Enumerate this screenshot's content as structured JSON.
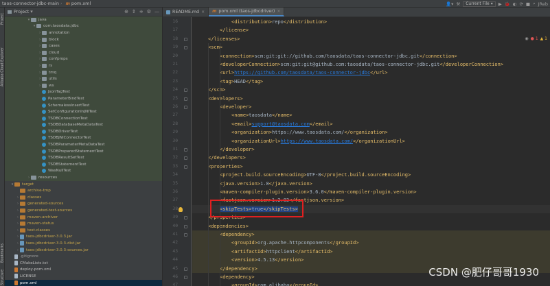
{
  "topbar": {
    "project_name": "taos-connector-jdbc-main",
    "file_name": "pom.xml",
    "run_config": "Current File"
  },
  "left_strip": {
    "tabs": [
      "Project",
      "Alibaba Cloud Explorer",
      "Bookmarks",
      "Structure"
    ]
  },
  "project_panel": {
    "title": "Project",
    "tree": [
      {
        "label": "java",
        "depth": 4,
        "arrow": "open",
        "icon": "folder",
        "style": "greenish"
      },
      {
        "label": "com.taosdata.jdbc",
        "depth": 5,
        "arrow": "open",
        "icon": "pkg",
        "style": "greenish"
      },
      {
        "label": "annotation",
        "depth": 6,
        "arrow": "closed",
        "icon": "pkg",
        "style": "greenish"
      },
      {
        "label": "block",
        "depth": 6,
        "arrow": "closed",
        "icon": "pkg",
        "style": "greenish"
      },
      {
        "label": "cases",
        "depth": 6,
        "arrow": "closed",
        "icon": "pkg",
        "style": "greenish"
      },
      {
        "label": "cloud",
        "depth": 6,
        "arrow": "closed",
        "icon": "pkg",
        "style": "greenish"
      },
      {
        "label": "confprops",
        "depth": 6,
        "arrow": "closed",
        "icon": "pkg",
        "style": "greenish"
      },
      {
        "label": "rs",
        "depth": 6,
        "arrow": "closed",
        "icon": "pkg",
        "style": "greenish"
      },
      {
        "label": "tmq",
        "depth": 6,
        "arrow": "closed",
        "icon": "pkg",
        "style": "greenish"
      },
      {
        "label": "utils",
        "depth": 6,
        "arrow": "closed",
        "icon": "pkg",
        "style": "greenish"
      },
      {
        "label": "ws",
        "depth": 6,
        "arrow": "closed",
        "icon": "pkg",
        "style": "greenish"
      },
      {
        "label": "JsonTagTest",
        "depth": 6,
        "arrow": "",
        "icon": "class",
        "style": "greenish"
      },
      {
        "label": "ParameterBindTest",
        "depth": 6,
        "arrow": "",
        "icon": "class",
        "style": "greenish"
      },
      {
        "label": "SchemalessInsertTest",
        "depth": 6,
        "arrow": "",
        "icon": "class",
        "style": "greenish"
      },
      {
        "label": "SetConfigurationInJNITest",
        "depth": 6,
        "arrow": "",
        "icon": "class",
        "style": "greenish"
      },
      {
        "label": "TSDBConnectionTest",
        "depth": 6,
        "arrow": "",
        "icon": "class",
        "style": "greenish"
      },
      {
        "label": "TSDBDatabaseMetaDataTest",
        "depth": 6,
        "arrow": "",
        "icon": "class",
        "style": "greenish"
      },
      {
        "label": "TSDBDriverTest",
        "depth": 6,
        "arrow": "",
        "icon": "class",
        "style": "greenish"
      },
      {
        "label": "TSDBJNIConnectorTest",
        "depth": 6,
        "arrow": "",
        "icon": "class",
        "style": "greenish"
      },
      {
        "label": "TSDBParameterMetaDataTest",
        "depth": 6,
        "arrow": "",
        "icon": "class",
        "style": "greenish"
      },
      {
        "label": "TSDBPreparedStatementTest",
        "depth": 6,
        "arrow": "",
        "icon": "class",
        "style": "greenish"
      },
      {
        "label": "TSDBResultSetTest",
        "depth": 6,
        "arrow": "",
        "icon": "class",
        "style": "greenish"
      },
      {
        "label": "TSDBStatementTest",
        "depth": 6,
        "arrow": "",
        "icon": "class",
        "style": "greenish"
      },
      {
        "label": "WasNullTest",
        "depth": 6,
        "arrow": "",
        "icon": "class",
        "style": "greenish"
      },
      {
        "label": "resources",
        "depth": 4,
        "arrow": "closed",
        "icon": "folder",
        "style": "greenish"
      },
      {
        "label": "target",
        "depth": 1,
        "arrow": "open",
        "icon": "folder-orange",
        "style": "yellowish"
      },
      {
        "label": "archive-tmp",
        "depth": 2,
        "arrow": "",
        "icon": "folder-orange",
        "style": "yellowish"
      },
      {
        "label": "classes",
        "depth": 2,
        "arrow": "closed",
        "icon": "folder-orange",
        "style": "yellowish"
      },
      {
        "label": "generated-sources",
        "depth": 2,
        "arrow": "closed",
        "icon": "folder-orange",
        "style": "yellowish"
      },
      {
        "label": "generated-test-sources",
        "depth": 2,
        "arrow": "closed",
        "icon": "folder-orange",
        "style": "yellowish"
      },
      {
        "label": "maven-archiver",
        "depth": 2,
        "arrow": "closed",
        "icon": "folder-orange",
        "style": "yellowish"
      },
      {
        "label": "maven-status",
        "depth": 2,
        "arrow": "closed",
        "icon": "folder-orange",
        "style": "yellowish"
      },
      {
        "label": "test-classes",
        "depth": 2,
        "arrow": "closed",
        "icon": "folder-orange",
        "style": "yellowish"
      },
      {
        "label": "taos-jdbcdriver-3.0.3.jar",
        "depth": 2,
        "arrow": "closed",
        "icon": "jar",
        "style": "yellowish"
      },
      {
        "label": "taos-jdbcdriver-3.0.3-dist.jar",
        "depth": 2,
        "arrow": "closed",
        "icon": "jar",
        "style": "yellowish"
      },
      {
        "label": "taos-jdbcdriver-3.0.3-sources.jar",
        "depth": 2,
        "arrow": "closed",
        "icon": "jar",
        "style": "yellowish"
      },
      {
        "label": ".gitignore",
        "depth": 1,
        "arrow": "",
        "icon": "file",
        "style": "gray"
      },
      {
        "label": "CMakeLists.txt",
        "depth": 1,
        "arrow": "",
        "icon": "file",
        "style": "normal"
      },
      {
        "label": "deploy-pom.xml",
        "depth": 1,
        "arrow": "",
        "icon": "xml",
        "style": "normal"
      },
      {
        "label": "LICENSE",
        "depth": 1,
        "arrow": "",
        "icon": "file",
        "style": "normal"
      },
      {
        "label": "pom.xml",
        "depth": 1,
        "arrow": "",
        "icon": "xml",
        "style": "selected"
      },
      {
        "label": "README.md",
        "depth": 1,
        "arrow": "",
        "icon": "file",
        "style": "normal"
      }
    ]
  },
  "editor": {
    "tabs": [
      {
        "label": "README.md",
        "active": false,
        "icon": "md-icon"
      },
      {
        "label": "pom.xml (taos-jdbcdriver)",
        "active": true,
        "icon": "m-icon"
      }
    ],
    "inspections": {
      "errors": "1",
      "warnings": "1"
    },
    "lines": [
      {
        "num": "16",
        "indent": 3,
        "tokens": [
          [
            "tag",
            "<distribution>"
          ],
          [
            "txt",
            "repo"
          ],
          [
            "tag",
            "</distribution>"
          ]
        ]
      },
      {
        "num": "17",
        "indent": 2,
        "tokens": [
          [
            "tag",
            "</license>"
          ]
        ]
      },
      {
        "num": "18",
        "indent": 1,
        "tokens": [
          [
            "tag",
            "</licenses>"
          ]
        ]
      },
      {
        "num": "19",
        "indent": 1,
        "tokens": [
          [
            "tag",
            "<scm>"
          ]
        ]
      },
      {
        "num": "20",
        "indent": 2,
        "tokens": [
          [
            "tag",
            "<connection>"
          ],
          [
            "txt",
            "scm:git:git://github.com/taosdata/taos-connector-jdbc.git"
          ],
          [
            "tag",
            "</connection>"
          ]
        ]
      },
      {
        "num": "21",
        "indent": 2,
        "tokens": [
          [
            "tag",
            "<developerConnection>"
          ],
          [
            "txt",
            "scm:git:git@github.com:taosdata/taos-connector-jdbc.git"
          ],
          [
            "tag",
            "</developerConnection>"
          ]
        ]
      },
      {
        "num": "22",
        "indent": 2,
        "tokens": [
          [
            "tag",
            "<url>"
          ],
          [
            "url",
            "https://github.com/taosdata/taos-connector-jdbc"
          ],
          [
            "tag",
            "</url>"
          ]
        ]
      },
      {
        "num": "23",
        "indent": 2,
        "tokens": [
          [
            "tag",
            "<tag>"
          ],
          [
            "txt",
            "HEAD"
          ],
          [
            "tag",
            "</tag>"
          ]
        ]
      },
      {
        "num": "24",
        "indent": 1,
        "tokens": [
          [
            "tag",
            "</scm>"
          ]
        ]
      },
      {
        "num": "25",
        "indent": 1,
        "tokens": [
          [
            "tag",
            "<developers>"
          ]
        ]
      },
      {
        "num": "26",
        "indent": 2,
        "tokens": [
          [
            "tag",
            "<developer>"
          ]
        ]
      },
      {
        "num": "27",
        "indent": 3,
        "tokens": [
          [
            "tag",
            "<name>"
          ],
          [
            "txt",
            "taosdata"
          ],
          [
            "tag",
            "</name>"
          ]
        ]
      },
      {
        "num": "28",
        "indent": 3,
        "tokens": [
          [
            "tag",
            "<email>"
          ],
          [
            "url",
            "support@taosdata.com"
          ],
          [
            "tag",
            "</email>"
          ]
        ]
      },
      {
        "num": "29",
        "indent": 3,
        "tokens": [
          [
            "tag",
            "<organization>"
          ],
          [
            "txt",
            "https://www.taosdata.com/"
          ],
          [
            "tag",
            "</organization>"
          ]
        ]
      },
      {
        "num": "30",
        "indent": 3,
        "tokens": [
          [
            "tag",
            "<organizationUrl>"
          ],
          [
            "url",
            "https://www.taosdata.com/"
          ],
          [
            "tag",
            "</organizationUrl>"
          ]
        ]
      },
      {
        "num": "31",
        "indent": 2,
        "tokens": [
          [
            "tag",
            "</developer>"
          ]
        ]
      },
      {
        "num": "32",
        "indent": 1,
        "tokens": [
          [
            "tag",
            "</developers>"
          ]
        ]
      },
      {
        "num": "33",
        "indent": 1,
        "tokens": [
          [
            "tag",
            "<properties>"
          ]
        ]
      },
      {
        "num": "34",
        "indent": 2,
        "tokens": [
          [
            "tag",
            "<project.build.sourceEncoding>"
          ],
          [
            "txt",
            "UTF-8"
          ],
          [
            "tag",
            "</project.build.sourceEncoding>"
          ]
        ]
      },
      {
        "num": "35",
        "indent": 2,
        "tokens": [
          [
            "tag",
            "<java.version>"
          ],
          [
            "txt",
            "1.8"
          ],
          [
            "tag",
            "</java.version>"
          ]
        ]
      },
      {
        "num": "36",
        "indent": 2,
        "tokens": [
          [
            "tag",
            "<maven-compiler-plugin.version>"
          ],
          [
            "txt",
            "3.6.0"
          ],
          [
            "tag",
            "</maven-compiler-plugin.version>"
          ]
        ]
      },
      {
        "num": "37",
        "indent": 2,
        "tokens": [
          [
            "tag",
            "<fastjson.version>"
          ],
          [
            "txt",
            "1.2.83"
          ],
          [
            "tag",
            "</fastjson.version>"
          ]
        ]
      },
      {
        "num": "38",
        "indent": 2,
        "tokens": [
          [
            "sel-tag",
            "<skipTests>"
          ],
          [
            "sel-txt",
            "true"
          ],
          [
            "sel-tag",
            "</skipTests>"
          ]
        ]
      },
      {
        "num": "39",
        "indent": 1,
        "tokens": [
          [
            "tag",
            "</properties>"
          ]
        ]
      },
      {
        "num": "40",
        "indent": 1,
        "tokens": [
          [
            "tag",
            "<dependencies>"
          ]
        ]
      },
      {
        "num": "41",
        "indent": 2,
        "tokens": [
          [
            "tag",
            "<dependency>"
          ]
        ]
      },
      {
        "num": "42",
        "indent": 3,
        "tokens": [
          [
            "tag",
            "<groupId>"
          ],
          [
            "txt",
            "org.apache.httpcomponents"
          ],
          [
            "tag",
            "</groupId>"
          ]
        ]
      },
      {
        "num": "43",
        "indent": 3,
        "tokens": [
          [
            "tag",
            "<artifactId>"
          ],
          [
            "txt",
            "httpclient"
          ],
          [
            "tag",
            "</artifactId>"
          ]
        ]
      },
      {
        "num": "44",
        "indent": 3,
        "tokens": [
          [
            "tag",
            "<version>"
          ],
          [
            "txt",
            "4.5.13"
          ],
          [
            "tag",
            "</version>"
          ]
        ]
      },
      {
        "num": "45",
        "indent": 2,
        "tokens": [
          [
            "tag",
            "</dependency>"
          ]
        ]
      },
      {
        "num": "46",
        "indent": 2,
        "tokens": [
          [
            "tag",
            "<dependency>"
          ]
        ]
      },
      {
        "num": "47",
        "indent": 3,
        "tokens": [
          [
            "tag",
            "<groupId>"
          ],
          [
            "txt",
            "com.alibaba"
          ],
          [
            "tag",
            "</groupId>"
          ]
        ]
      }
    ]
  },
  "watermark": "CSDN @肥仔哥哥1930",
  "colors": {
    "tag": "#e8bf6a",
    "text": "#a9b7c6",
    "url": "#287bde",
    "selection": "#214283",
    "annotation_box": "#e02020"
  }
}
